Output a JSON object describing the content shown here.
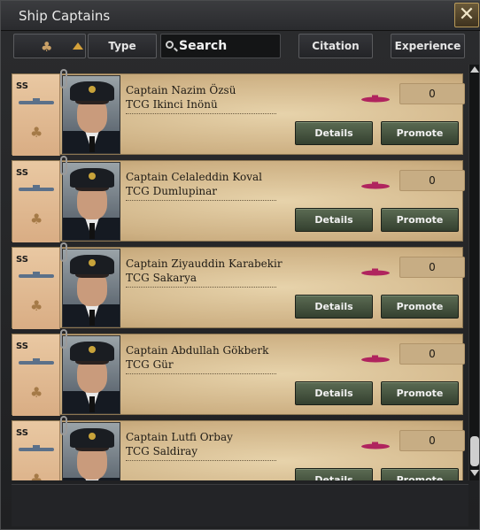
{
  "window": {
    "title": "Ship Captains",
    "close_glyph": "✕"
  },
  "toolbar": {
    "filter_icon": "clover-icon",
    "sort_icon": "sort-asc-triangle-icon",
    "type_label": "Type",
    "search_placeholder": "Search",
    "citation_label": "Citation",
    "experience_label": "Experience"
  },
  "captains": [
    {
      "rank": "SS",
      "name": "Captain Nazim Özsü",
      "ship": "TCG Ikinci Inönü",
      "experience": "0",
      "details_label": "Details",
      "promote_label": "Promote"
    },
    {
      "rank": "SS",
      "name": "Captain Celaleddin Koval",
      "ship": "TCG Dumlupinar",
      "experience": "0",
      "details_label": "Details",
      "promote_label": "Promote"
    },
    {
      "rank": "SS",
      "name": "Captain Ziyauddin Karabekir",
      "ship": "TCG Sakarya",
      "experience": "0",
      "details_label": "Details",
      "promote_label": "Promote"
    },
    {
      "rank": "SS",
      "name": "Captain Abdullah Gökberk",
      "ship": "TCG Gür",
      "experience": "0",
      "details_label": "Details",
      "promote_label": "Promote"
    },
    {
      "rank": "SS",
      "name": "Captain Lutfi Orbay",
      "ship": "TCG Saldiray",
      "experience": "0",
      "details_label": "Details",
      "promote_label": "Promote"
    }
  ],
  "colors": {
    "accent_submarine": "#b0245e",
    "button_green": "#4b5a44",
    "card_paper": "#dcc39a"
  }
}
